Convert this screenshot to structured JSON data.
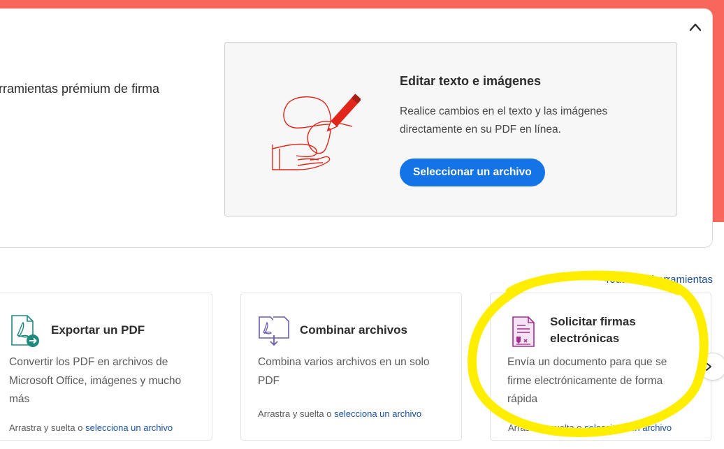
{
  "hero": {
    "partial_text": "rramientas prémium de firma",
    "feature": {
      "title": "Editar texto e imágenes",
      "description": "Realice cambios en el texto y las imágenes directamente en su PDF en línea.",
      "button_label": "Seleccionar un archivo",
      "illustration_icon": "hand-signature-pen-icon"
    }
  },
  "tools": {
    "all_tools_link": "Todas las herramientas",
    "cards": [
      {
        "title": "Exportar un PDF",
        "description": "Convertir los PDF en archivos de Microsoft Office, imágenes y mucho más",
        "footer_text": "Arrastra y suelta o",
        "footer_link": "selecciona un archivo",
        "icon": "export-pdf-icon"
      },
      {
        "title": "Combinar archivos",
        "description": "Combina varios archivos en un solo PDF",
        "footer_text": "Arrastra y suelta o",
        "footer_link": "selecciona un archivo",
        "icon": "combine-files-icon"
      },
      {
        "title": "Solicitar firmas electrónicas",
        "description": "Envía un documento para que se firme electrónicamente de forma rápida",
        "footer_text": "Arrastra y suelta o",
        "footer_link": "selecciona un archivo",
        "icon": "request-signatures-icon"
      }
    ]
  },
  "colors": {
    "brand_coral": "#f8665c",
    "accent_blue": "#1473e6",
    "link_blue": "#1a52a3",
    "illustration_red": "#e1251b",
    "highlight_yellow": "#ffee00"
  }
}
